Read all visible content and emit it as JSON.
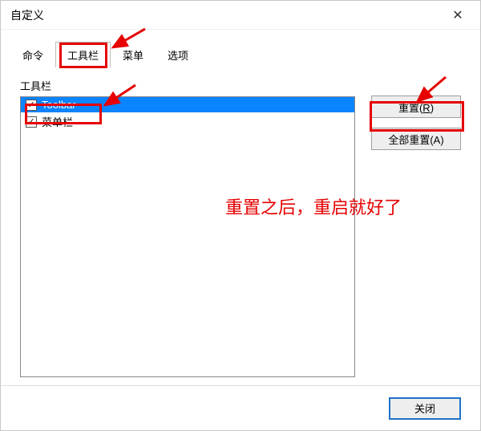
{
  "window": {
    "title": "自定义"
  },
  "tabs": [
    {
      "label": "命令",
      "active": false
    },
    {
      "label": "工具栏",
      "active": true
    },
    {
      "label": "菜单",
      "active": false
    },
    {
      "label": "选项",
      "active": false
    }
  ],
  "group": {
    "label": "工具栏"
  },
  "list": {
    "items": [
      {
        "label": "Toolbar",
        "checked": true,
        "selected": true
      },
      {
        "label": "菜单栏",
        "checked": true,
        "selected": false
      }
    ]
  },
  "buttons": {
    "reset_prefix": "重置(",
    "reset_hotkey": "R",
    "reset_suffix": ")",
    "reset_all": "全部重置(A)",
    "close": "关闭"
  },
  "annotation": {
    "note": "重置之后，重启就好了"
  }
}
